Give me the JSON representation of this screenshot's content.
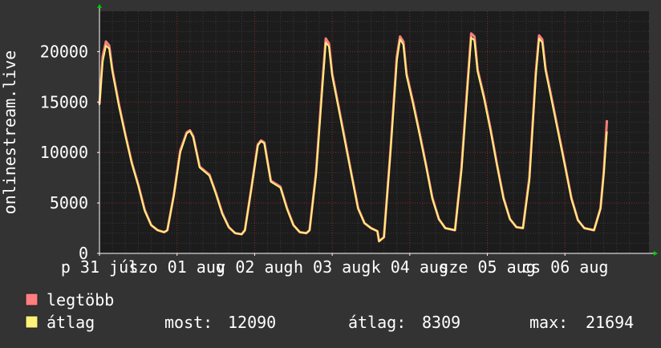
{
  "colors": {
    "background": "#333333",
    "plot_background": "#1c1c1c",
    "grid_minor": "#3a3a3a",
    "grid_major": "#8a2a2a",
    "max_series": "#ff7e7e",
    "avg_series": "#fff07a",
    "text": "#ffffff",
    "arrow": "#00cc00"
  },
  "chart_data": {
    "type": "line",
    "ylabel": "onlinestream.live",
    "ylim": [
      0,
      24000
    ],
    "yticks": [
      0,
      5000,
      10000,
      15000,
      20000
    ],
    "grid": true,
    "xrange": [
      0,
      170
    ],
    "xticks": [
      {
        "label": "p 31 júl",
        "x": 0
      },
      {
        "label": "szo 01 aug",
        "x": 24
      },
      {
        "label": "v 02 aug",
        "x": 48
      },
      {
        "label": "h 03 aug",
        "x": 72
      },
      {
        "label": "k 04 aug",
        "x": 96
      },
      {
        "label": "sze 05 aug",
        "x": 120
      },
      {
        "label": "cs 06 aug",
        "x": 144
      }
    ],
    "series": [
      {
        "name": "legtöbb",
        "color": "#ff7e7e",
        "points": [
          [
            0,
            14800
          ],
          [
            1,
            19500
          ],
          [
            2,
            21000
          ],
          [
            3,
            20600
          ],
          [
            4,
            18200
          ],
          [
            6,
            14800
          ],
          [
            8,
            11800
          ],
          [
            10,
            9000
          ],
          [
            12,
            6800
          ],
          [
            14,
            4300
          ],
          [
            16,
            2800
          ],
          [
            18,
            2300
          ],
          [
            20,
            2100
          ],
          [
            21,
            2300
          ],
          [
            23,
            5800
          ],
          [
            25,
            10200
          ],
          [
            27,
            12000
          ],
          [
            28,
            12200
          ],
          [
            29,
            11600
          ],
          [
            31,
            8600
          ],
          [
            34,
            7800
          ],
          [
            36,
            6000
          ],
          [
            38,
            4000
          ],
          [
            40,
            2600
          ],
          [
            42,
            2000
          ],
          [
            44,
            1900
          ],
          [
            45,
            2300
          ],
          [
            47,
            6500
          ],
          [
            49,
            10800
          ],
          [
            50,
            11200
          ],
          [
            51,
            11000
          ],
          [
            53,
            7200
          ],
          [
            56,
            6600
          ],
          [
            58,
            4500
          ],
          [
            60,
            2800
          ],
          [
            62,
            2100
          ],
          [
            64,
            2000
          ],
          [
            65,
            2300
          ],
          [
            67,
            8000
          ],
          [
            69,
            17000
          ],
          [
            70,
            21300
          ],
          [
            71,
            20800
          ],
          [
            72,
            17800
          ],
          [
            74,
            14500
          ],
          [
            76,
            11200
          ],
          [
            78,
            7800
          ],
          [
            80,
            4500
          ],
          [
            82,
            3000
          ],
          [
            84,
            2500
          ],
          [
            86,
            2200
          ],
          [
            86.5,
            1200
          ],
          [
            88,
            1600
          ],
          [
            90,
            10000
          ],
          [
            92,
            19500
          ],
          [
            93,
            21500
          ],
          [
            94,
            21000
          ],
          [
            95,
            17800
          ],
          [
            97,
            15000
          ],
          [
            99,
            12000
          ],
          [
            101,
            8800
          ],
          [
            103,
            5500
          ],
          [
            105,
            3400
          ],
          [
            107,
            2500
          ],
          [
            110,
            2300
          ],
          [
            112,
            8500
          ],
          [
            114,
            17500
          ],
          [
            115,
            21800
          ],
          [
            116,
            21500
          ],
          [
            117,
            18200
          ],
          [
            119,
            15500
          ],
          [
            121,
            12300
          ],
          [
            123,
            8800
          ],
          [
            125,
            5500
          ],
          [
            127,
            3400
          ],
          [
            129,
            2600
          ],
          [
            131,
            2500
          ],
          [
            133,
            7500
          ],
          [
            135,
            18000
          ],
          [
            136,
            21600
          ],
          [
            137,
            21200
          ],
          [
            138,
            18300
          ],
          [
            140,
            15200
          ],
          [
            142,
            12000
          ],
          [
            144,
            8800
          ],
          [
            146,
            5500
          ],
          [
            148,
            3300
          ],
          [
            150,
            2500
          ],
          [
            153,
            2300
          ],
          [
            155,
            4500
          ],
          [
            156,
            8000
          ],
          [
            157,
            13200
          ]
        ]
      },
      {
        "name": "átlag",
        "color": "#fff07a",
        "points": [
          [
            0,
            14700
          ],
          [
            1,
            19000
          ],
          [
            2,
            20600
          ],
          [
            3,
            20300
          ],
          [
            4,
            18000
          ],
          [
            6,
            14600
          ],
          [
            8,
            11700
          ],
          [
            10,
            8900
          ],
          [
            12,
            6700
          ],
          [
            14,
            4200
          ],
          [
            16,
            2800
          ],
          [
            18,
            2300
          ],
          [
            20,
            2100
          ],
          [
            21,
            2300
          ],
          [
            23,
            5700
          ],
          [
            25,
            10000
          ],
          [
            27,
            11900
          ],
          [
            28,
            12100
          ],
          [
            29,
            11500
          ],
          [
            31,
            8500
          ],
          [
            34,
            7700
          ],
          [
            36,
            5900
          ],
          [
            38,
            3900
          ],
          [
            40,
            2600
          ],
          [
            42,
            2000
          ],
          [
            44,
            1900
          ],
          [
            45,
            2300
          ],
          [
            47,
            6400
          ],
          [
            49,
            10700
          ],
          [
            50,
            11100
          ],
          [
            51,
            10900
          ],
          [
            53,
            7100
          ],
          [
            56,
            6500
          ],
          [
            58,
            4400
          ],
          [
            60,
            2800
          ],
          [
            62,
            2100
          ],
          [
            64,
            2000
          ],
          [
            65,
            2300
          ],
          [
            67,
            7800
          ],
          [
            69,
            16500
          ],
          [
            70,
            20900
          ],
          [
            71,
            20500
          ],
          [
            72,
            17600
          ],
          [
            74,
            14300
          ],
          [
            76,
            11000
          ],
          [
            78,
            7700
          ],
          [
            80,
            4400
          ],
          [
            82,
            3000
          ],
          [
            84,
            2500
          ],
          [
            86,
            2200
          ],
          [
            86.5,
            1200
          ],
          [
            88,
            1600
          ],
          [
            90,
            9800
          ],
          [
            92,
            19100
          ],
          [
            93,
            21200
          ],
          [
            94,
            20700
          ],
          [
            95,
            17600
          ],
          [
            97,
            14800
          ],
          [
            99,
            11800
          ],
          [
            101,
            8700
          ],
          [
            103,
            5400
          ],
          [
            105,
            3400
          ],
          [
            107,
            2500
          ],
          [
            110,
            2300
          ],
          [
            112,
            8200
          ],
          [
            114,
            17100
          ],
          [
            115,
            21400
          ],
          [
            116,
            21100
          ],
          [
            117,
            18000
          ],
          [
            119,
            15300
          ],
          [
            121,
            12100
          ],
          [
            123,
            8700
          ],
          [
            125,
            5400
          ],
          [
            127,
            3400
          ],
          [
            129,
            2600
          ],
          [
            131,
            2500
          ],
          [
            133,
            7200
          ],
          [
            135,
            17600
          ],
          [
            136,
            21300
          ],
          [
            137,
            20900
          ],
          [
            138,
            18100
          ],
          [
            140,
            15000
          ],
          [
            142,
            11800
          ],
          [
            144,
            8700
          ],
          [
            146,
            5400
          ],
          [
            148,
            3300
          ],
          [
            150,
            2500
          ],
          [
            153,
            2300
          ],
          [
            155,
            4400
          ],
          [
            156,
            7800
          ],
          [
            157,
            12090
          ]
        ]
      }
    ]
  },
  "legend": {
    "items": [
      {
        "label": "legtöbb",
        "color": "#ff7e7e"
      },
      {
        "label": "átlag",
        "color": "#fff07a"
      }
    ],
    "stats": [
      {
        "label": "most:",
        "value": "12090"
      },
      {
        "label": "átlag:",
        "value": "8309"
      },
      {
        "label": "max:",
        "value": "21694"
      }
    ]
  }
}
